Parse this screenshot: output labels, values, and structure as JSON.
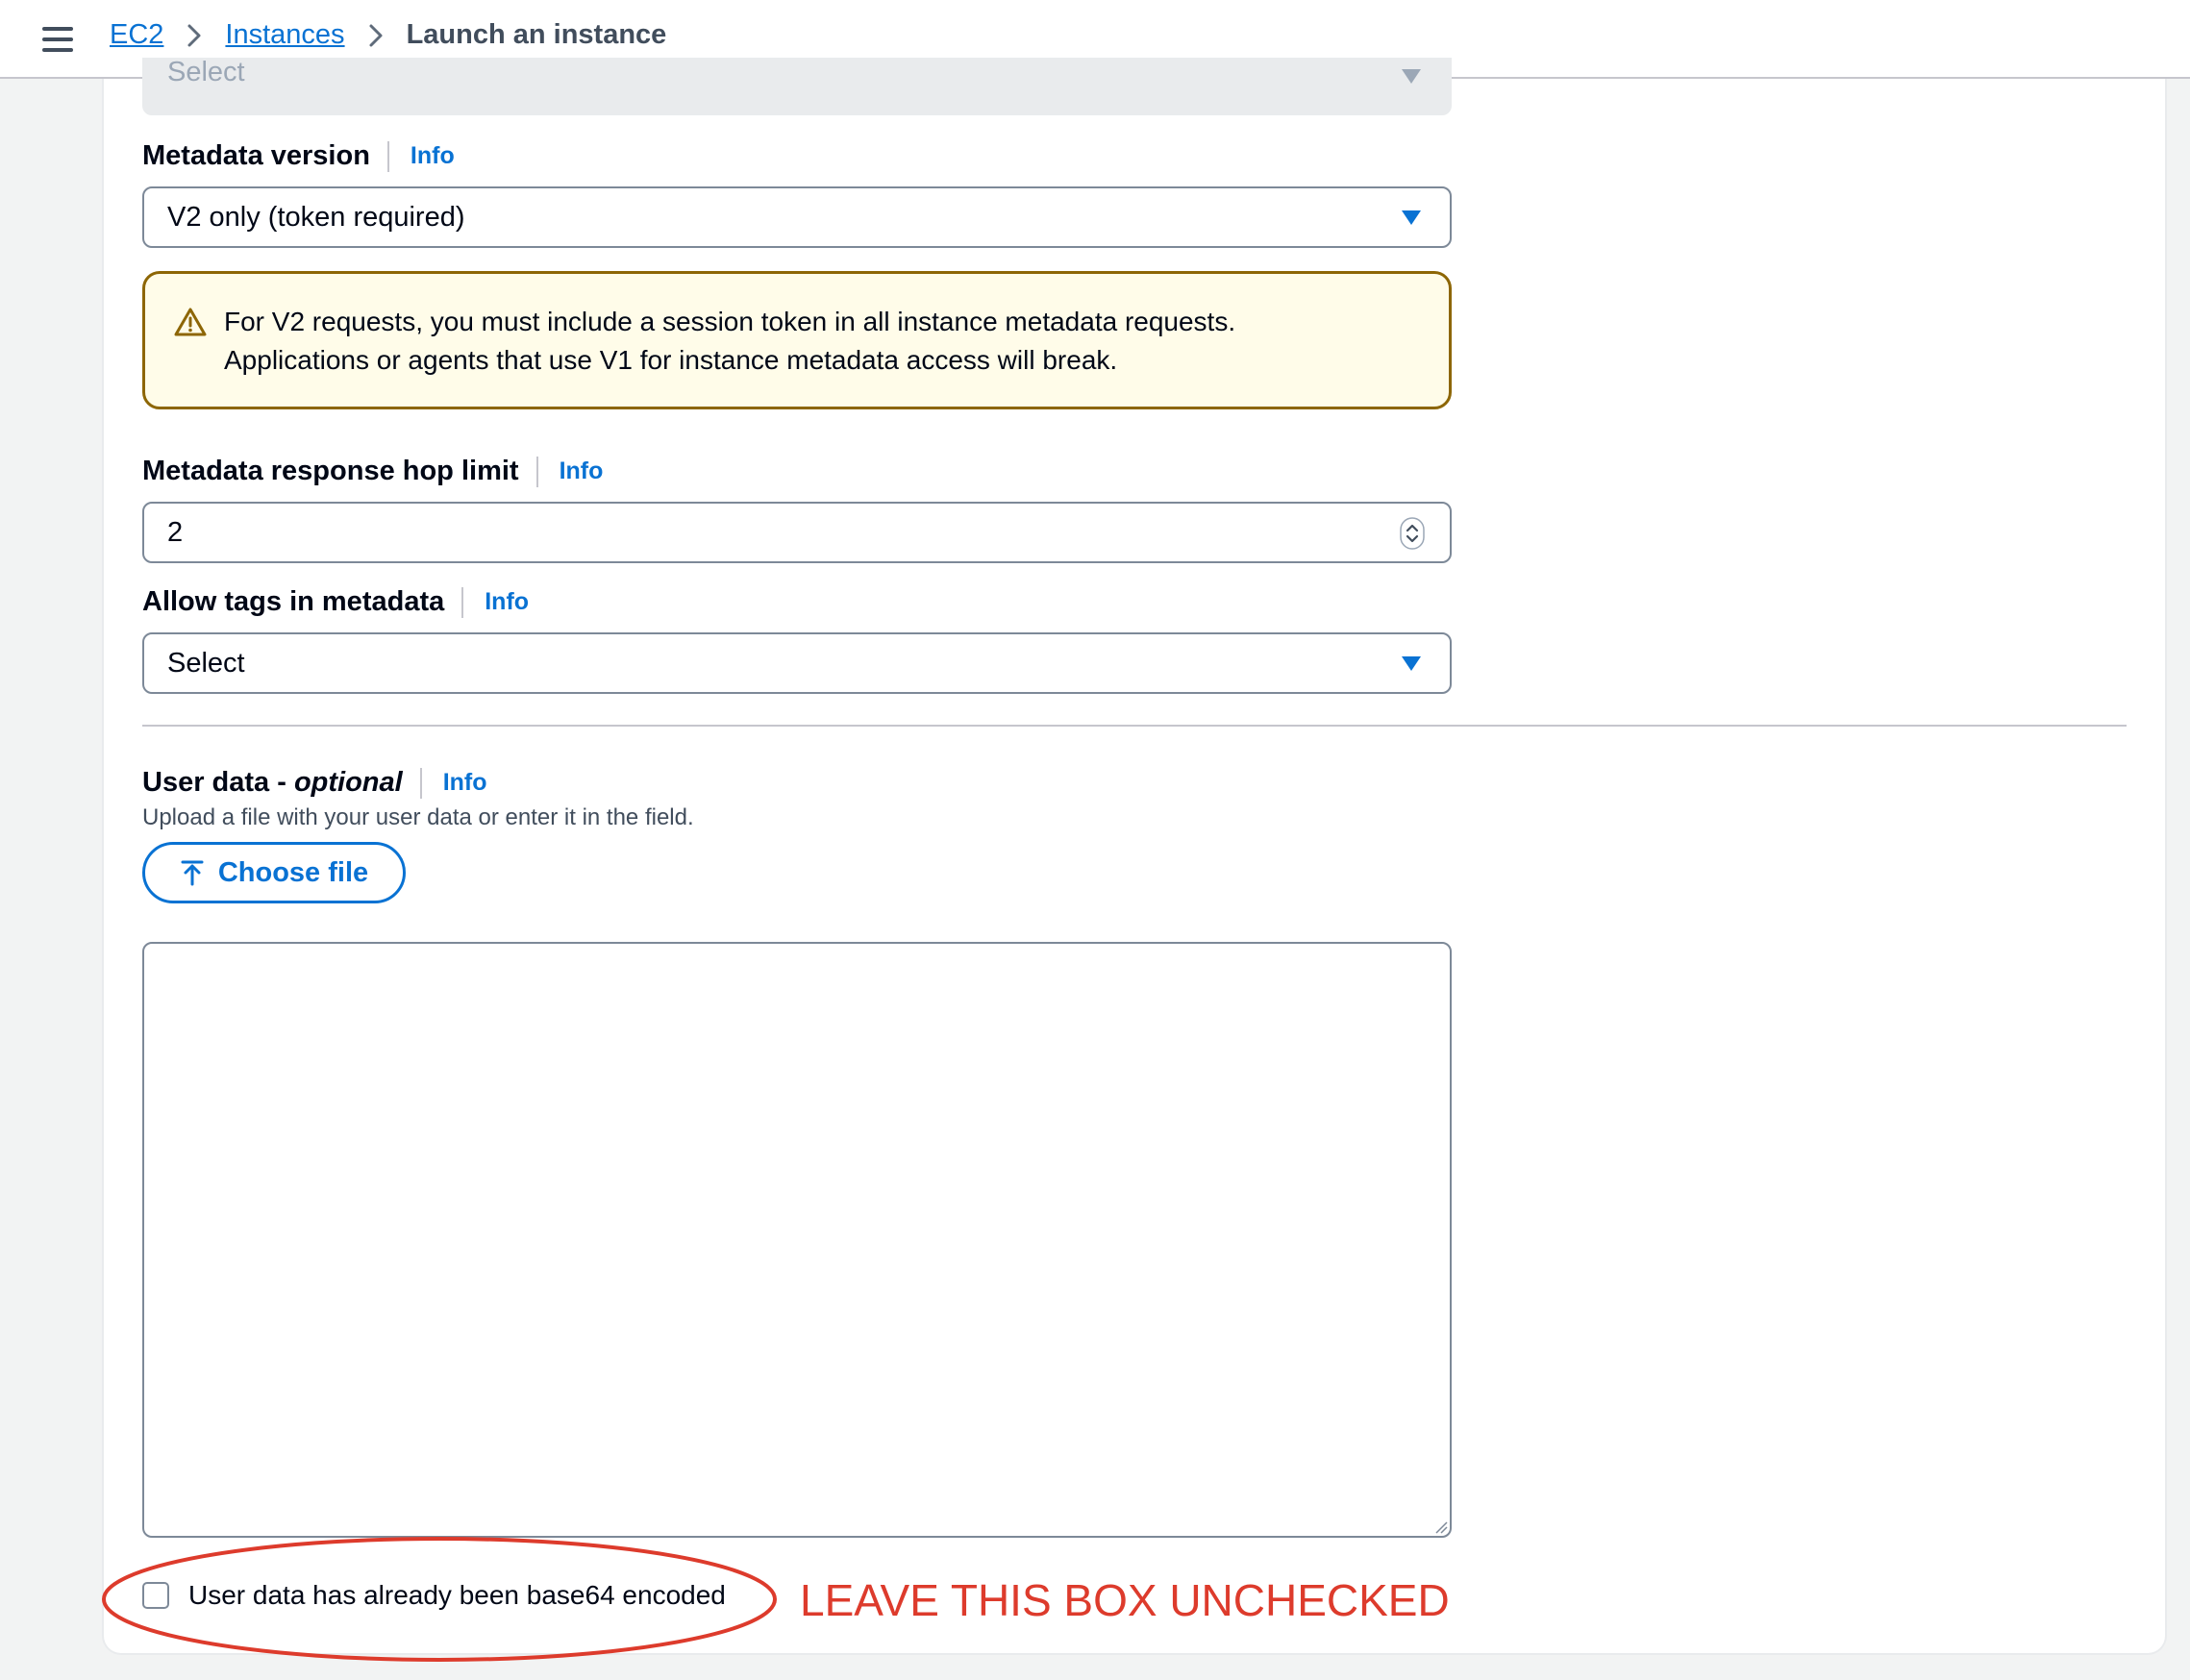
{
  "breadcrumbs": {
    "ec2": "EC2",
    "instances": "Instances",
    "current": "Launch an instance"
  },
  "top_select": {
    "placeholder": "Select"
  },
  "metadata_version": {
    "label": "Metadata version",
    "info": "Info",
    "value": "V2 only (token required)"
  },
  "alert": {
    "line1": "For V2 requests, you must include a session token in all instance metadata requests.",
    "line2": "Applications or agents that use V1 for instance metadata access will break."
  },
  "hop_limit": {
    "label": "Metadata response hop limit",
    "info": "Info",
    "value": "2"
  },
  "allow_tags": {
    "label": "Allow tags in metadata",
    "info": "Info",
    "value": "Select"
  },
  "user_data": {
    "label": "User data",
    "dash": " - ",
    "optional": "optional",
    "info": "Info",
    "description": "Upload a file with your user data or enter it in the field.",
    "choose_file": "Choose file",
    "content": "",
    "base64_label": "User data has already been base64 encoded",
    "base64_checked": false
  },
  "annotation": {
    "text": "LEAVE THIS BOX UNCHECKED",
    "color": "#dd3b2c"
  },
  "colors": {
    "link": "#0972d3",
    "warning_border": "#8d6605",
    "warning_bg": "#fffce9"
  }
}
